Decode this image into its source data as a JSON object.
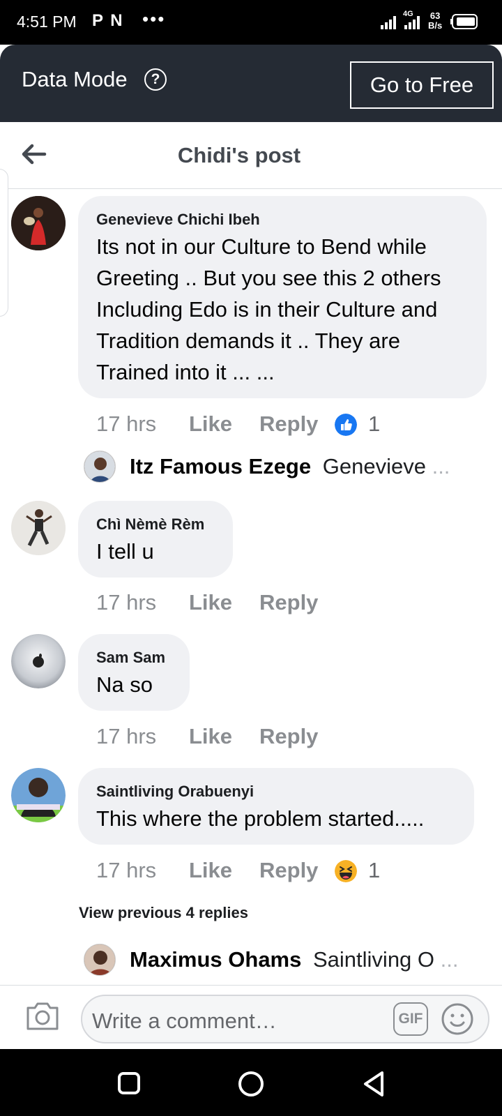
{
  "status_bar": {
    "time": "4:51 PM",
    "app_icons": "P N",
    "more": "•••",
    "network_type": "4G",
    "speed_value": "63",
    "speed_unit": "B/s"
  },
  "data_mode": {
    "label": "Data Mode",
    "help_glyph": "?",
    "go_free_label": "Go to Free"
  },
  "header": {
    "title": "Chidi's post"
  },
  "comments": [
    {
      "author": "Genevieve Chichi Ibeh",
      "lines": [
        "Its not in our Culture to Bend while",
        "Greeting .. But you see this 2 others",
        "Including Edo is in their Culture and",
        "Tradition demands it .. They are",
        "Trained into it ... ..."
      ],
      "time": "17 hrs",
      "like_label": "Like",
      "reply_label": "Reply",
      "reaction": "like",
      "reaction_count": "1",
      "reply_preview": {
        "author": "Itz Famous Ezege",
        "text": "Genevieve",
        "ellipsis": "..."
      }
    },
    {
      "author": "Chì Nèmè Rèm",
      "lines": [
        "I tell u"
      ],
      "time": "17 hrs",
      "like_label": "Like",
      "reply_label": "Reply"
    },
    {
      "author": "Sam Sam",
      "lines": [
        "Na so"
      ],
      "time": "17 hrs",
      "like_label": "Like",
      "reply_label": "Reply"
    },
    {
      "author": "Saintliving Orabuenyi",
      "lines": [
        "This where the problem started....."
      ],
      "time": "17 hrs",
      "like_label": "Like",
      "reply_label": "Reply",
      "reaction": "haha",
      "reaction_count": "1",
      "view_previous": "View previous 4 replies",
      "reply_preview": {
        "author": "Maximus Ohams",
        "text": "Saintliving O",
        "ellipsis": "..."
      }
    }
  ],
  "composer": {
    "placeholder": "Write a comment…",
    "gif_label": "GIF"
  },
  "colors": {
    "like_blue": "#1877f2",
    "haha_yellow": "#f7b125",
    "bubble_bg": "#f0f1f4",
    "data_bar": "#252b34"
  }
}
